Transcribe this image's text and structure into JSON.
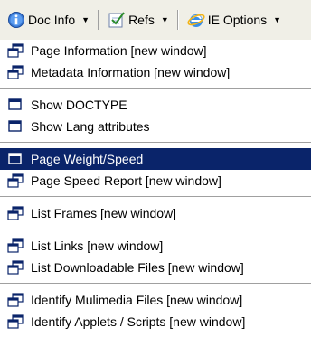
{
  "toolbar": {
    "doc_info": {
      "label": "Doc Info",
      "icon": "info-icon"
    },
    "refs": {
      "label": "Refs",
      "icon": "checklist-icon"
    },
    "ie_options": {
      "label": "IE Options",
      "icon": "ie-icon"
    }
  },
  "menu": {
    "groups": [
      [
        {
          "label": "Page Information [new window]",
          "icon": "new-window-icon"
        },
        {
          "label": "Metadata Information [new window]",
          "icon": "new-window-icon"
        }
      ],
      [
        {
          "label": "Show DOCTYPE",
          "icon": "window-icon"
        },
        {
          "label": "Show Lang attributes",
          "icon": "window-icon"
        }
      ],
      [
        {
          "label": "Page Weight/Speed",
          "icon": "window-icon",
          "active": true
        },
        {
          "label": "Page Speed Report [new window]",
          "icon": "new-window-icon"
        }
      ],
      [
        {
          "label": "List Frames [new window]",
          "icon": "new-window-icon"
        }
      ],
      [
        {
          "label": "List Links [new window]",
          "icon": "new-window-icon"
        },
        {
          "label": "List Downloadable Files [new window]",
          "icon": "new-window-icon"
        }
      ],
      [
        {
          "label": "Identify Mulimedia Files [new window]",
          "icon": "new-window-icon"
        },
        {
          "label": "Identify Applets / Scripts [new window]",
          "icon": "new-window-icon"
        }
      ]
    ]
  },
  "colors": {
    "highlight": "#0a246a",
    "toolbar_bg": "#f0efe7",
    "separator": "#a0a0a0"
  }
}
